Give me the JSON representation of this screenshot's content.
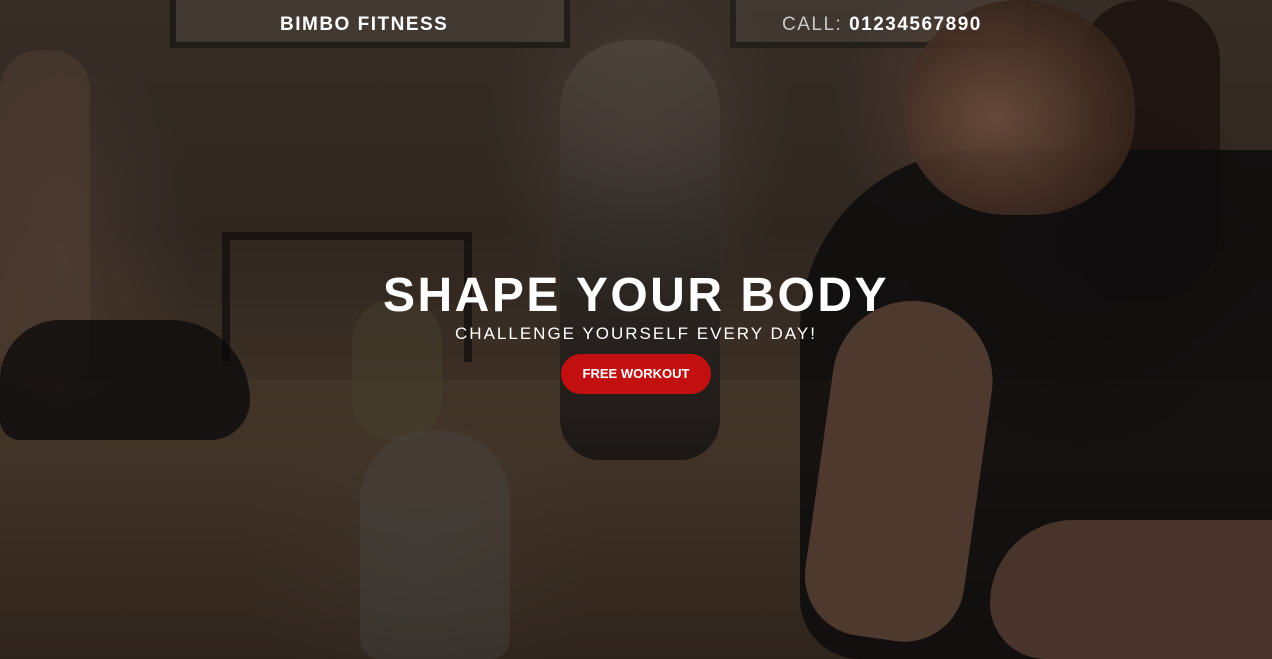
{
  "header": {
    "brand": "BIMBO FITNESS",
    "phone_label": "CALL:",
    "phone_number": "01234567890"
  },
  "hero": {
    "headline": "SHAPE YOUR BODY",
    "subline": "CHALLENGE YOURSELF EVERY DAY!",
    "cta_label": "FREE WORKOUT"
  },
  "colors": {
    "accent": "#c20f0f",
    "text": "#ffffff",
    "muted_text": "#c9c9c9"
  }
}
